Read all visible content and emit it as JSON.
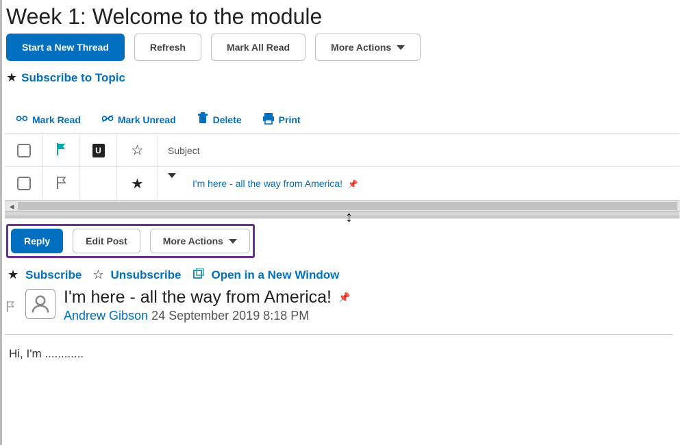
{
  "page_title": "Week 1: Welcome to the module",
  "top_buttons": {
    "new_thread": "Start a New Thread",
    "refresh": "Refresh",
    "mark_all_read": "Mark All Read",
    "more_actions": "More Actions"
  },
  "subscribe_topic": "Subscribe to Topic",
  "toolbar": {
    "mark_read": "Mark Read",
    "mark_unread": "Mark Unread",
    "delete": "Delete",
    "print": "Print"
  },
  "table": {
    "subject_header": "Subject",
    "row1_subject": "I'm here - all the way from America!"
  },
  "post_actions": {
    "reply": "Reply",
    "edit_post": "Edit Post",
    "more_actions": "More Actions"
  },
  "post_links": {
    "subscribe": "Subscribe",
    "unsubscribe": "Unsubscribe",
    "open_new_window": "Open in a New Window"
  },
  "post": {
    "title": "I'm here - all the way from America!",
    "author": "Andrew Gibson",
    "timestamp": "24 September 2019 8:18 PM",
    "body": "Hi, I'm ............"
  }
}
